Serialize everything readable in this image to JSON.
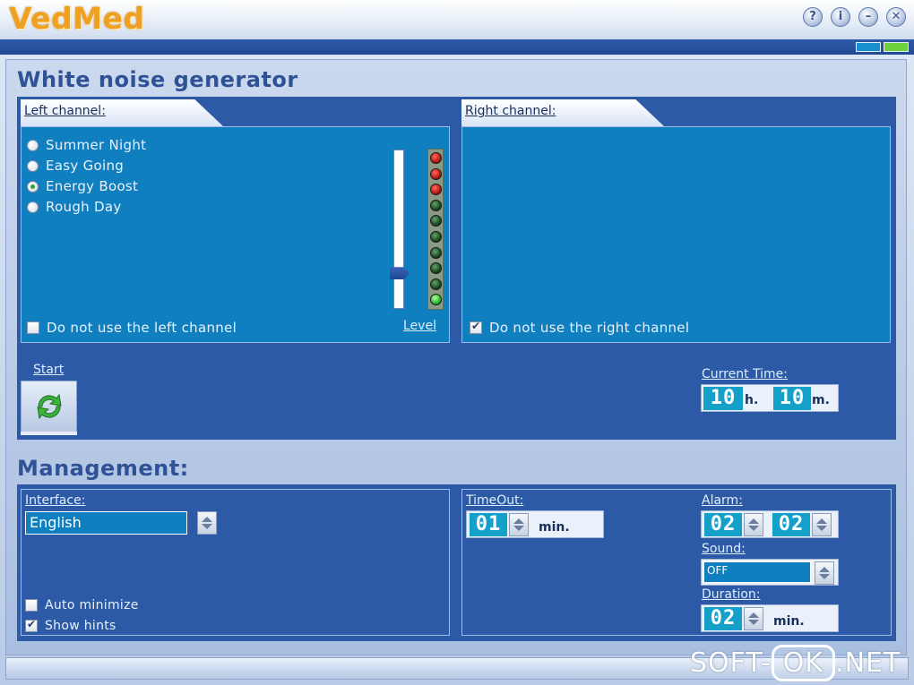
{
  "app": {
    "title": "VedMed"
  },
  "titlebar": {
    "help_glyph": "?",
    "info_glyph": "i",
    "minimize_glyph": "–",
    "close_glyph": "✕"
  },
  "white_noise": {
    "title": "White noise generator",
    "left_tab": "Left channel:",
    "right_tab": "Right channel:",
    "options": [
      {
        "label": "Summer Night",
        "selected": false
      },
      {
        "label": "Easy Going",
        "selected": false
      },
      {
        "label": "Energy Boost",
        "selected": true
      },
      {
        "label": "Rough Day",
        "selected": false
      }
    ],
    "left_disable_label": "Do not use the left channel",
    "left_disable_checked": false,
    "right_disable_label": "Do not use the right channel",
    "right_disable_checked": true,
    "level_label": "Level",
    "level_value": 0.2,
    "start_label": "Start",
    "current_time_label": "Current Time:",
    "hours": "10",
    "hours_unit": "h.",
    "minutes": "10",
    "minutes_unit": "m."
  },
  "management": {
    "title": "Management:",
    "interface_label": "Interface:",
    "interface_value": "English",
    "auto_minimize_label": "Auto minimize",
    "auto_minimize_checked": false,
    "show_hints_label": "Show hints",
    "show_hints_checked": true,
    "timeout_label": "TimeOut:",
    "timeout_value": "01",
    "timeout_unit": "min.",
    "alarm_label": "Alarm:",
    "alarm_hours": "02",
    "alarm_minutes": "02",
    "sound_label": "Sound:",
    "sound_value": "OFF",
    "duration_label": "Duration:",
    "duration_value": "02",
    "duration_unit": "min."
  },
  "watermark": {
    "left": "SOFT-",
    "middle": "OK",
    "right": ".NET"
  },
  "colors": {
    "panel": "#2d5aa6",
    "inner": "#0f7fc0",
    "accent": "#f0a020",
    "led_red": "#c0201a",
    "led_green": "#2fbf3a"
  }
}
